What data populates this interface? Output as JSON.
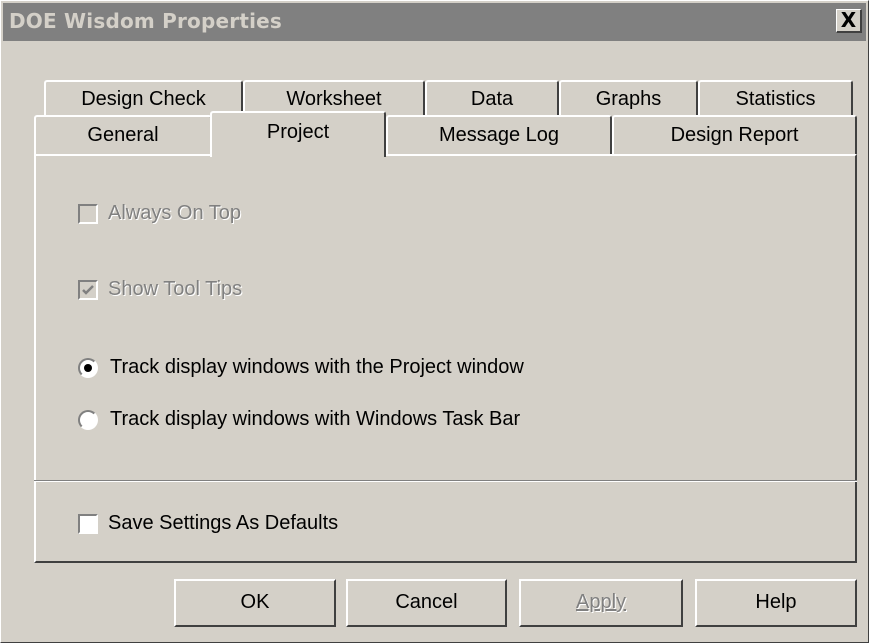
{
  "window": {
    "title": "DOE Wisdom Properties",
    "close_glyph": "X"
  },
  "tabs": {
    "row1": [
      "Design Check",
      "Worksheet",
      "Data",
      "Graphs",
      "Statistics"
    ],
    "row2": [
      "General",
      "Project",
      "Message Log",
      "Design Report"
    ],
    "active": "Project"
  },
  "options": {
    "always_on_top": {
      "label": "Always On Top",
      "checked": false,
      "enabled": false
    },
    "show_tool_tips": {
      "label": "Show Tool Tips",
      "checked": true,
      "enabled": false
    },
    "track_project": {
      "label": "Track display windows with the Project window",
      "selected": true
    },
    "track_taskbar": {
      "label": "Track display windows with Windows Task Bar",
      "selected": false
    },
    "save_defaults": {
      "label": "Save Settings As Defaults",
      "checked": false
    }
  },
  "buttons": {
    "ok": "OK",
    "cancel": "Cancel",
    "apply": "Apply",
    "help": "Help"
  },
  "icons": {
    "check": "checkmark-icon",
    "close": "close-icon"
  }
}
